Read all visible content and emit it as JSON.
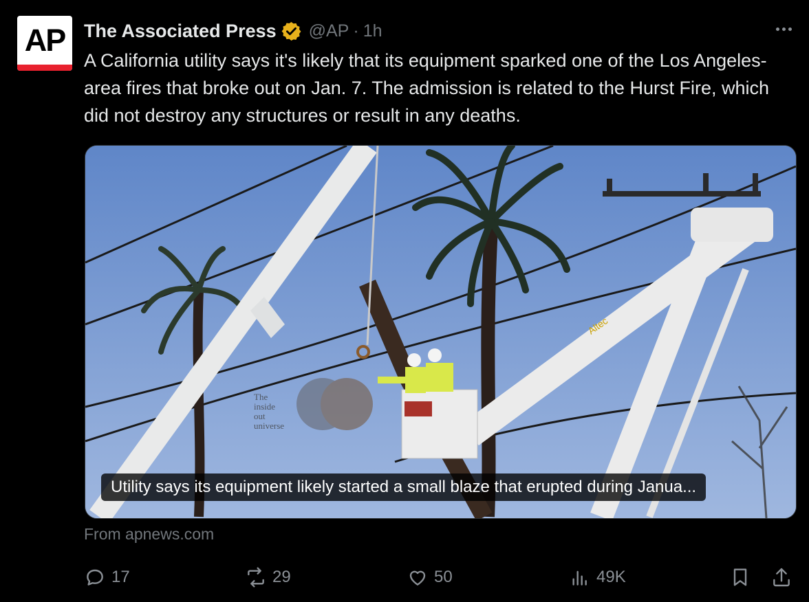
{
  "avatar": {
    "logo_text": "AP",
    "bar_color": "#e8212e"
  },
  "tweet": {
    "author_name": "The Associated Press",
    "handle": "@AP",
    "separator": "·",
    "time": "1h",
    "text": "A California utility says it's likely that its equipment sparked one of the Los Angeles-area fires that broke out on Jan. 7. The admission is related to the Hurst Fire, which did not destroy any structures or result in any deaths.",
    "verified_badge_color": "#e8b11b"
  },
  "link_card": {
    "caption": "Utility says its equipment likely started a small blaze that erupted during Janua...",
    "source": "From apnews.com",
    "image_labels": {
      "boom_brand": "Altec",
      "watermark": [
        "The",
        "inside",
        "out",
        "universe"
      ]
    }
  },
  "actions": {
    "replies": "17",
    "reposts": "29",
    "likes": "50",
    "views": "49K"
  },
  "icons": [
    "verified-badge-icon",
    "more-options-icon",
    "reply-icon",
    "repost-icon",
    "like-icon",
    "views-icon",
    "bookmark-icon",
    "share-icon"
  ]
}
